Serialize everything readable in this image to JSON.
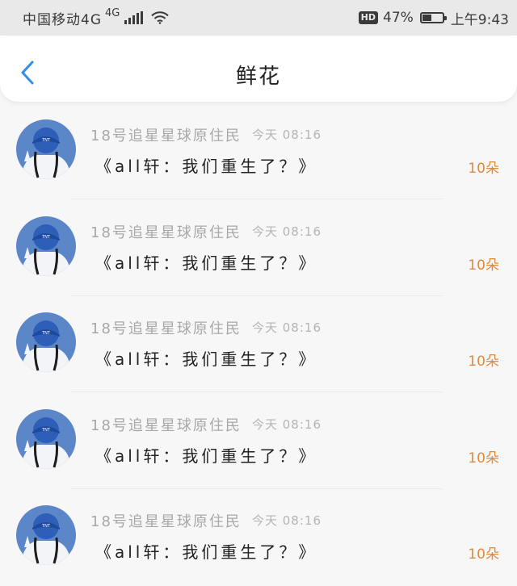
{
  "status_bar": {
    "carrier": "中国移动4G",
    "network": "4G",
    "hd": "HD",
    "battery_percent": "47%",
    "battery_level": 0.47,
    "time": "上午9:43"
  },
  "header": {
    "title": "鲜花"
  },
  "colors": {
    "accent_blue": "#2f8cf0",
    "amount_orange": "#e08a3e"
  },
  "list": {
    "items": [
      {
        "username": "18号追星星球原住民",
        "time": "今天 08:16",
        "message": "《all轩：我们重生了？》",
        "amount": "10朵"
      },
      {
        "username": "18号追星星球原住民",
        "time": "今天 08:16",
        "message": "《all轩：我们重生了？》",
        "amount": "10朵"
      },
      {
        "username": "18号追星星球原住民",
        "time": "今天 08:16",
        "message": "《all轩：我们重生了？》",
        "amount": "10朵"
      },
      {
        "username": "18号追星星球原住民",
        "time": "今天 08:16",
        "message": "《all轩：我们重生了？》",
        "amount": "10朵"
      },
      {
        "username": "18号追星星球原住民",
        "time": "今天 08:16",
        "message": "《all轩：我们重生了？》",
        "amount": "10朵"
      }
    ]
  }
}
